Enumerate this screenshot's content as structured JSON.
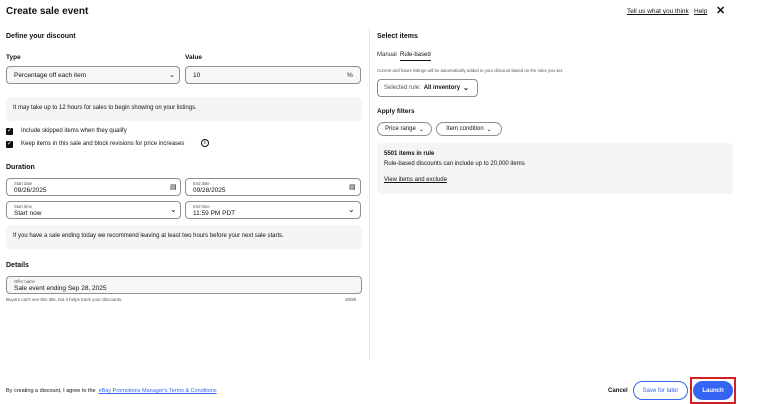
{
  "header": {
    "title": "Create sale event",
    "feedback_link": "Tell us what you think",
    "help_link": "Help",
    "close_glyph": "✕"
  },
  "discount": {
    "heading": "Define your discount",
    "type_label": "Type",
    "type_value": "Percentage off each item",
    "value_label": "Value",
    "value_value": "10",
    "value_suffix": "%",
    "info_text": "It may take up to 12 hours for sales to begin showing on your listings.",
    "checkbox_1": "Include skipped items when they qualify",
    "checkbox_2": "Keep items in this sale and block revisions for price increases"
  },
  "duration": {
    "heading": "Duration",
    "start_date_label": "Start date",
    "start_date_value": "09/26/2025",
    "end_date_label": "End date",
    "end_date_value": "09/28/2025",
    "start_time_label": "Start time",
    "start_time_value": "Start now",
    "end_time_label": "End time",
    "end_time_value": "11:59 PM PDT",
    "info_text": "If you have a sale ending today we recommend leaving at least two hours before your next sale starts."
  },
  "details": {
    "heading": "Details",
    "offer_name_label": "Offer name",
    "offer_name_value": "Sale event ending Sep 28, 2025",
    "helper_text": "Buyers can't see this title, but it helps track your discounts.",
    "char_count": "30/90"
  },
  "items": {
    "heading": "Select items",
    "tab_manual": "Manual",
    "tab_rule": "Rule-based",
    "rule_description": "Current and future listings will be automatically added to your discount based on the rules you set.",
    "selected_rule_prefix": "Selected rule:",
    "selected_rule_value": "All inventory",
    "filters_heading": "Apply filters",
    "filter_price": "Price range",
    "filter_condition": "Item condition",
    "summary_count": "5501 items in rule",
    "summary_text": "Rule-based discounts can include up to 20,000 items",
    "summary_link": "View items and exclude"
  },
  "footer": {
    "agreement_prefix": "By creating a discount, I agree to the",
    "agreement_link": "eBay Promotions Manager's Terms & Conditions",
    "cancel_label": "Cancel",
    "save_label": "Save for later",
    "launch_label": "Launch"
  },
  "colors": {
    "accent": "#3665f3",
    "highlight": "#d42020"
  }
}
